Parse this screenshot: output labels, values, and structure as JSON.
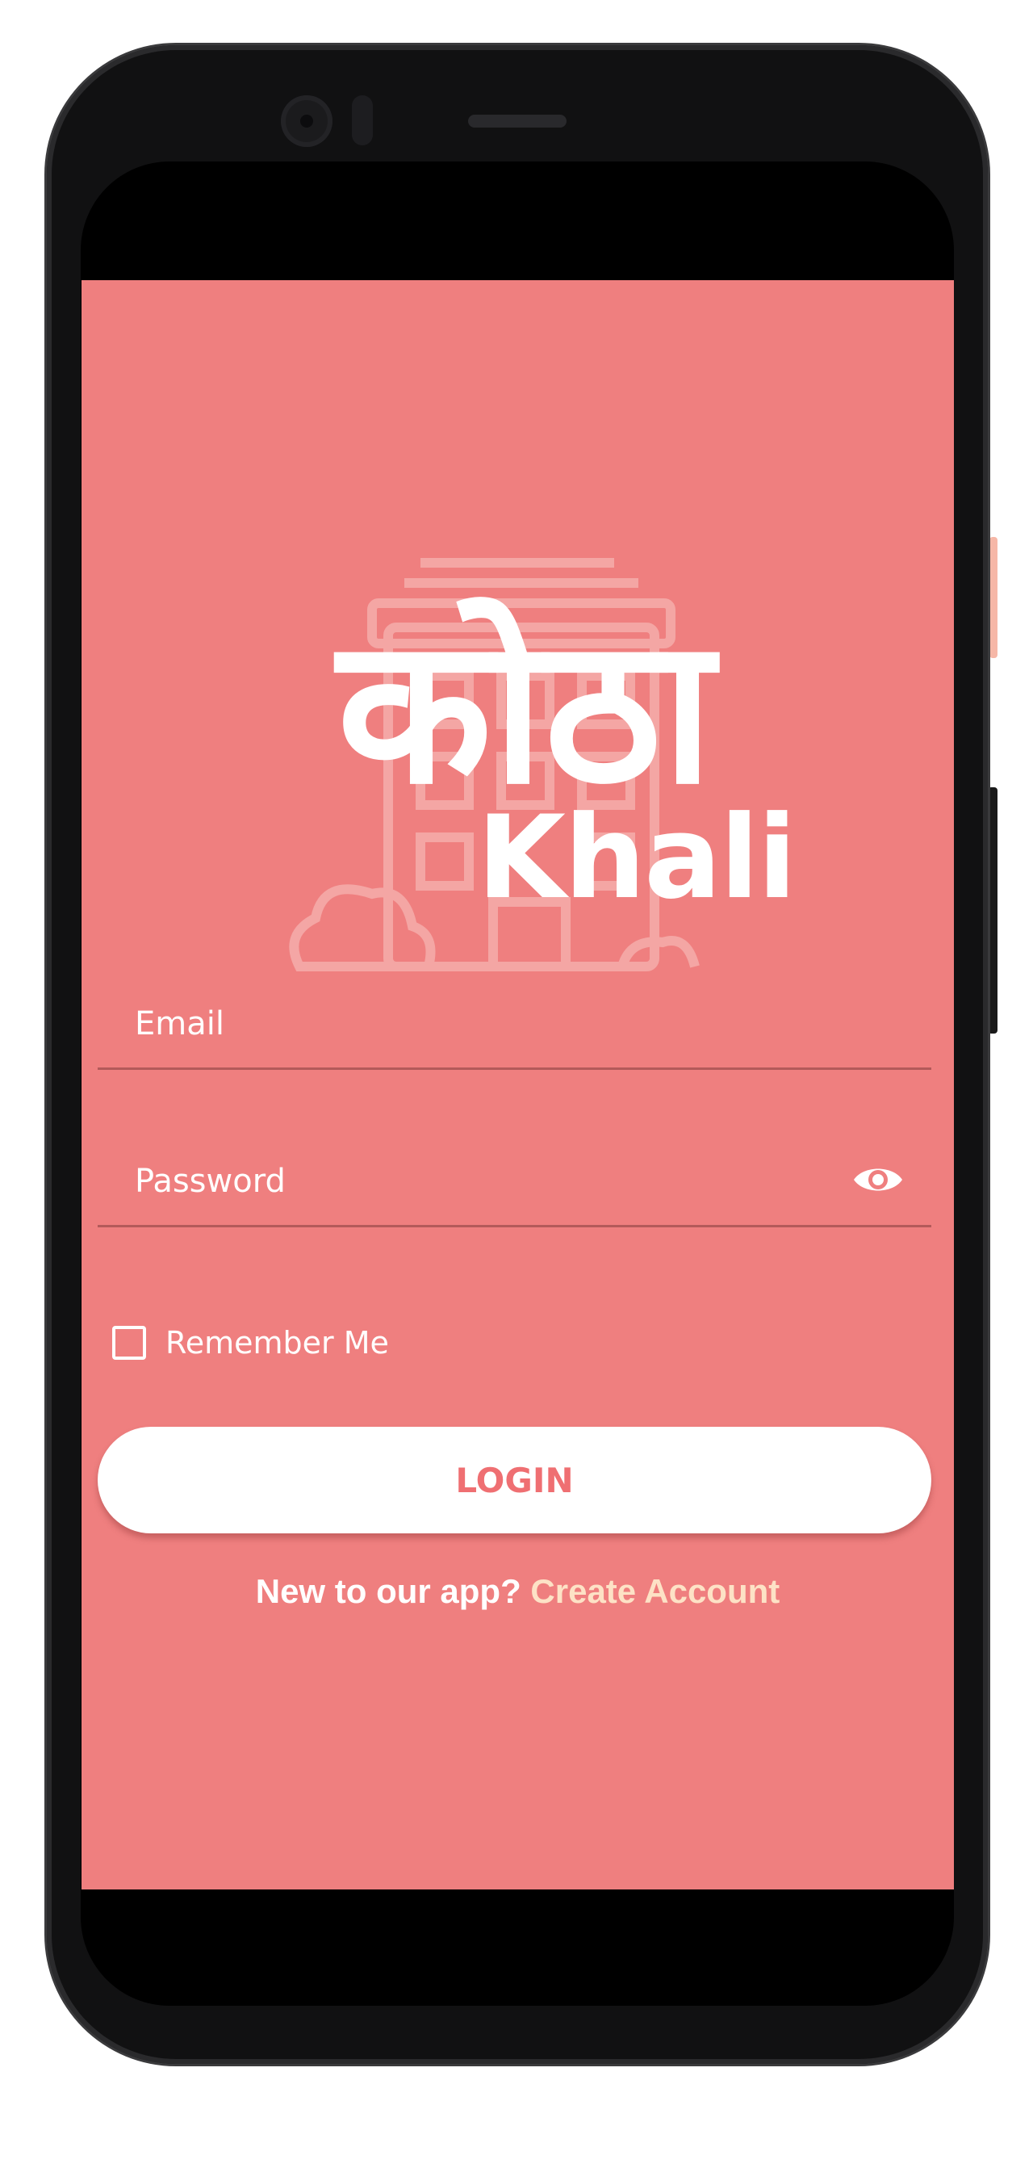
{
  "logo": {
    "devanagari_text": "कोठा",
    "latin_text": "Khali",
    "background_icon": "building-icon"
  },
  "form": {
    "email_placeholder": "Email",
    "password_placeholder": "Password",
    "password_toggle_icon": "eye-icon",
    "remember_label": "Remember Me",
    "remember_checked": false,
    "login_label": "LOGIN"
  },
  "signup": {
    "prompt": "New to our app?",
    "link_label": "Create Account"
  },
  "colors": {
    "background": "#ef7f7f",
    "accent_button_text": "#ef6f72",
    "link": "#fde2c6"
  }
}
